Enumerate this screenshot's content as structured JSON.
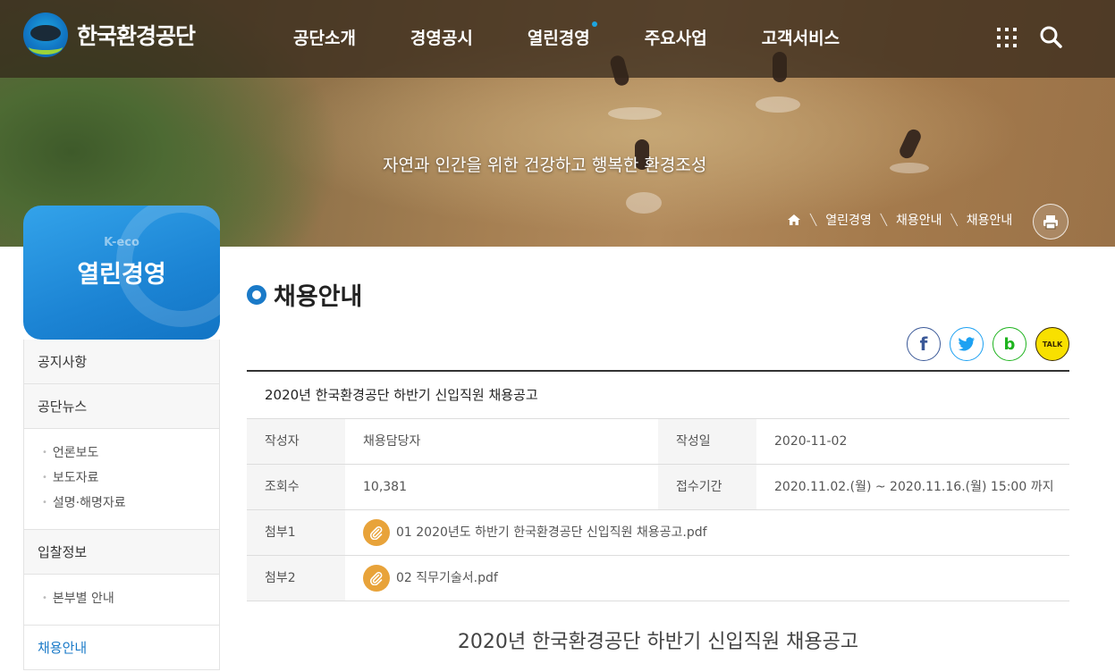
{
  "header": {
    "logo_text": "한국환경공단",
    "nav": [
      "공단소개",
      "경영공시",
      "열린경영",
      "주요사업",
      "고객서비스"
    ],
    "active_nav_index": 2
  },
  "hero": {
    "slogan": "자연과 인간을 위한 건강하고 행복한 환경조성",
    "breadcrumb": [
      "열린경영",
      "채용안내",
      "채용안내"
    ]
  },
  "sidebar": {
    "sub": "K-eco",
    "title": "열린경영",
    "items": [
      {
        "label": "공지사항"
      },
      {
        "label": "공단뉴스",
        "children": [
          "언론보도",
          "보도자료",
          "설명·해명자료"
        ]
      },
      {
        "label": "입찰정보",
        "children": [
          "본부별 안내"
        ]
      },
      {
        "label": "채용안내",
        "active": true
      }
    ]
  },
  "main": {
    "page_title": "채용안내",
    "share": {
      "facebook": "f",
      "band": "b",
      "kakao": "TALK"
    },
    "post": {
      "title": "2020년 한국환경공단 하반기 신입직원 채용공고",
      "author_label": "작성자",
      "author": "채용담당자",
      "date_label": "작성일",
      "date": "2020-11-02",
      "views_label": "조회수",
      "views": "10,381",
      "period_label": "접수기간",
      "period": "2020.11.02.(월) ~ 2020.11.16.(월) 15:00 까지",
      "attach1_label": "첨부1",
      "attach1": "01 2020년도 하반기 한국환경공단 신입직원 채용공고.pdf",
      "attach2_label": "첨부2",
      "attach2": "02 직무기술서.pdf"
    },
    "doc_heading": "2020년 한국환경공단 하반기 신입직원 채용공고"
  },
  "colors": {
    "brand_blue": "#1a7ac8",
    "attach_orange": "#e8a33a"
  }
}
